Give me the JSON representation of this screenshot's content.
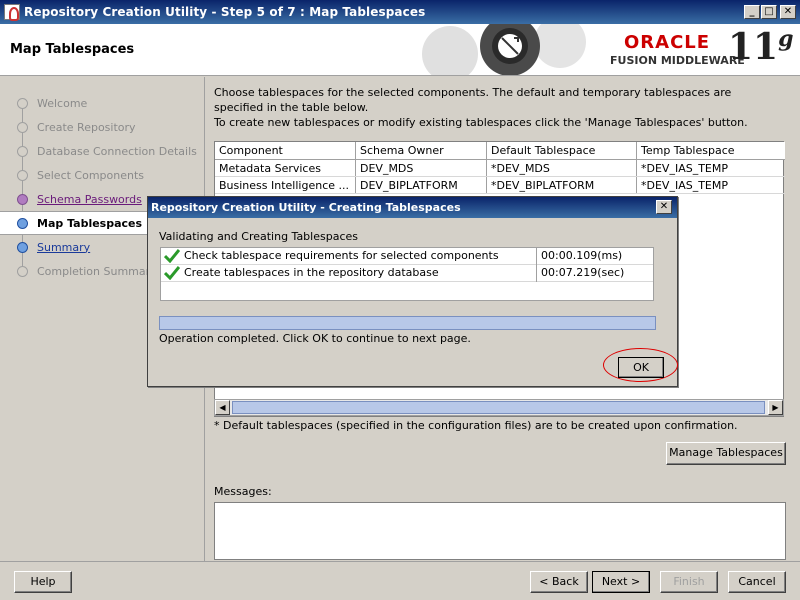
{
  "window": {
    "title": "Repository Creation Utility - Step 5 of 7 : Map Tablespaces",
    "minimize": "_",
    "maximize": "□",
    "close": "✕"
  },
  "header": {
    "page_title": "Map Tablespaces",
    "logo_oracle": "ORACLE",
    "logo_fmw": "FUSION MIDDLEWARE",
    "logo_version": "11",
    "logo_version_suffix": "g"
  },
  "nav": {
    "items": [
      {
        "label": "Welcome",
        "state": "done"
      },
      {
        "label": "Create Repository",
        "state": "done"
      },
      {
        "label": "Database Connection Details",
        "state": "done"
      },
      {
        "label": "Select Components",
        "state": "done"
      },
      {
        "label": "Schema Passwords",
        "state": "visited"
      },
      {
        "label": "Map Tablespaces",
        "state": "current"
      },
      {
        "label": "Summary",
        "state": "next"
      },
      {
        "label": "Completion Summary",
        "state": "done"
      }
    ]
  },
  "main": {
    "instruction_1": "Choose tablespaces for the selected components. The default and temporary tablespaces are specified in the table below.",
    "instruction_2": "To create new tablespaces or modify existing tablespaces click the 'Manage Tablespaces' button.",
    "table": {
      "headers": [
        "Component",
        "Schema Owner",
        "Default Tablespace",
        "Temp Tablespace"
      ],
      "rows": [
        [
          "Metadata Services",
          "DEV_MDS",
          "*DEV_MDS",
          "*DEV_IAS_TEMP"
        ],
        [
          "Business Intelligence ...",
          "DEV_BIPLATFORM",
          "*DEV_BIPLATFORM",
          "*DEV_IAS_TEMP"
        ]
      ]
    },
    "footnote": "* Default tablespaces (specified in the configuration files) are to be created upon confirmation.",
    "manage_button": "Manage Tablespaces",
    "messages_label": "Messages:"
  },
  "buttons": {
    "help": "Help",
    "back": "< Back",
    "next": "Next >",
    "finish": "Finish",
    "cancel": "Cancel"
  },
  "dialog": {
    "title": "Repository Creation Utility - Creating Tablespaces",
    "close": "✕",
    "heading": "Validating and Creating Tablespaces",
    "tasks": [
      {
        "name": "Check tablespace requirements for selected components",
        "time": "00:00.109(ms)"
      },
      {
        "name": "Create tablespaces in the repository database",
        "time": "00:07.219(sec)"
      }
    ],
    "progress": 1.0,
    "status": "Operation completed. Click OK to continue to next page.",
    "ok": "OK"
  },
  "colors": {
    "titlebar": "#0a246a",
    "oracle_red": "#c00000",
    "check_green": "#2a9a2a",
    "highlight_ring": "#dd0000"
  }
}
